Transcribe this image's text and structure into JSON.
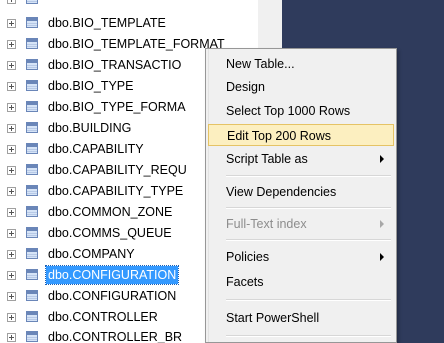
{
  "object_explorer": {
    "items": [
      {
        "label": "dbo.BIO_TEMPLATE"
      },
      {
        "label": "dbo.BIO_TEMPLATE_FORMAT"
      },
      {
        "label": "dbo.BIO_TRANSACTIO"
      },
      {
        "label": "dbo.BIO_TYPE"
      },
      {
        "label": "dbo.BIO_TYPE_FORMA"
      },
      {
        "label": "dbo.BUILDING"
      },
      {
        "label": "dbo.CAPABILITY"
      },
      {
        "label": "dbo.CAPABILITY_REQU"
      },
      {
        "label": "dbo.CAPABILITY_TYPE"
      },
      {
        "label": "dbo.COMMON_ZONE"
      },
      {
        "label": "dbo.COMMS_QUEUE"
      },
      {
        "label": "dbo.COMPANY"
      },
      {
        "label": "dbo.CONFIGURATION",
        "selected": true
      },
      {
        "label": "dbo.CONFIGURATION"
      },
      {
        "label": "dbo.CONTROLLER"
      },
      {
        "label": "dbo.CONTROLLER_BR"
      }
    ]
  },
  "context_menu": {
    "new_table": "New Table...",
    "design": "Design",
    "select_top": "Select Top 1000 Rows",
    "edit_top": "Edit Top 200 Rows",
    "script_table_as": "Script Table as",
    "view_dependencies": "View Dependencies",
    "full_text_index": "Full-Text index",
    "policies": "Policies",
    "facets": "Facets",
    "start_powershell": "Start PowerShell"
  },
  "colors": {
    "selection": "#3399ff",
    "menu_highlight": "#fcefc0",
    "dark_background": "#2f3b5c"
  }
}
